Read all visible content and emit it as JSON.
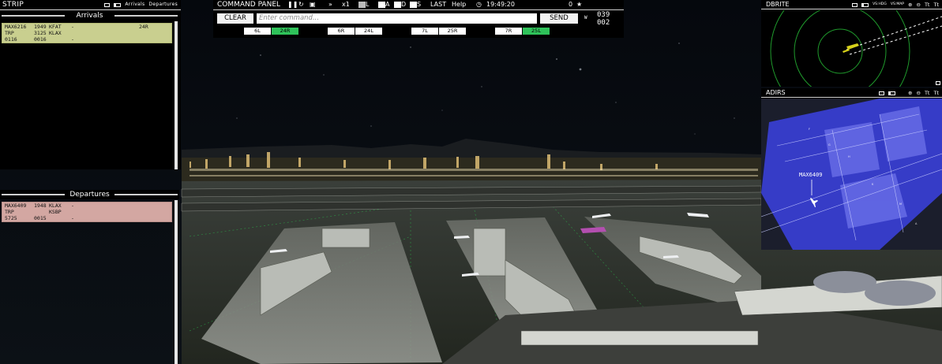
{
  "strip": {
    "title": "STRIP",
    "tab_arrivals": "Arrivals",
    "tab_departures": "Departures",
    "arrivals_header": "Arrivals",
    "departures_header": "Departures",
    "arrivals": [
      {
        "line1": [
          "MAX6216",
          "1949",
          "KFAT",
          "-",
          "24R"
        ],
        "line2": [
          "TRP",
          "3125",
          "KLAX",
          "",
          ""
        ],
        "line3": [
          "0116",
          "0016",
          "",
          "-",
          ""
        ]
      }
    ],
    "departures": [
      {
        "line1": [
          "MAX6409",
          "1948",
          "KLAX",
          "-",
          ""
        ],
        "line2": [
          "TRP",
          "",
          "KSBP",
          "",
          ""
        ],
        "line3": [
          "5725",
          "0015",
          "",
          "-",
          ""
        ]
      }
    ]
  },
  "command_panel": {
    "title": "COMMAND PANEL",
    "pause_icon": "pause-icon",
    "restart_icon": "restart-icon",
    "camera_icon": "camera-icon",
    "fast_forward": "»",
    "speed": "x1",
    "mode_l": "L",
    "mode_a": "A",
    "mode_d": "D",
    "mode_s": "S",
    "last": "LAST",
    "help": "Help",
    "time": "19:49:20",
    "score": "0",
    "clear_label": "CLEAR",
    "input_placeholder": "Enter command...",
    "send_label": "SEND",
    "wind_label": "W",
    "wind_dir": "039",
    "wind_speed": "002",
    "runways": [
      {
        "left": "6L",
        "right": "24R",
        "active": "right"
      },
      {
        "left": "6R",
        "right": "24L",
        "active": "none"
      },
      {
        "left": "7L",
        "right": "25R",
        "active": "none"
      },
      {
        "left": "7R",
        "right": "25L",
        "active": "right"
      }
    ]
  },
  "dbrite": {
    "title": "DBRITE",
    "vs_hdg": "VS:HDG",
    "vs_map": "VS:MAP"
  },
  "adirs": {
    "title": "ADIRS",
    "callsign": "MAX6409"
  },
  "colors": {
    "arrival_strip": "#c9cf8f",
    "departure_strip": "#d3a7a2",
    "runway_active": "#2fc25a",
    "radar_green": "#1f9a2c",
    "map_blue": "#3a3fd8"
  }
}
